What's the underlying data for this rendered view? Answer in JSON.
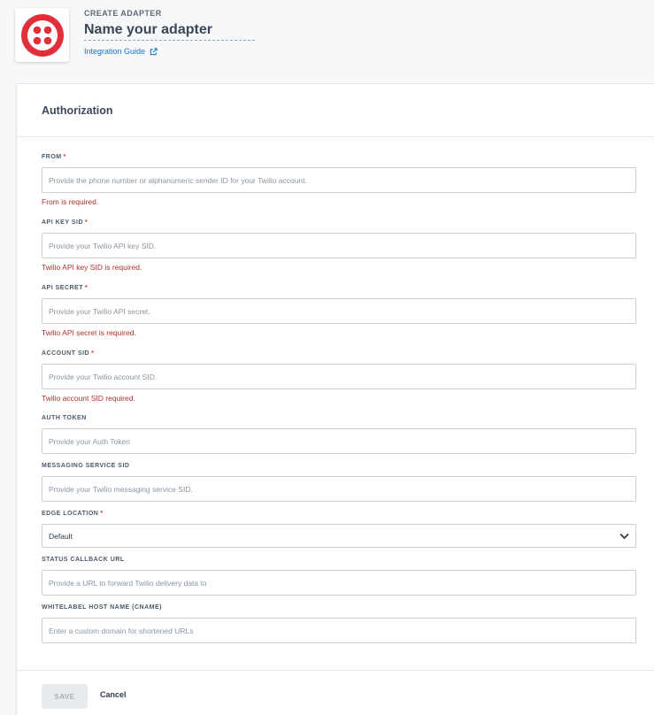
{
  "header": {
    "label": "CREATE ADAPTER",
    "name_placeholder": "Name your adapter",
    "guide_link": "Integration Guide"
  },
  "colors": {
    "brand": "#e12f3a",
    "link": "#1a73c7",
    "error": "#b0312a"
  },
  "card": {
    "title": "Authorization"
  },
  "fields": {
    "from": {
      "label": "FROM",
      "required": "*",
      "placeholder": "Provide the phone number or alphanumeric sender ID for your Twilio account.",
      "error": "From is required."
    },
    "api_key_sid": {
      "label": "API KEY SID",
      "required": "*",
      "placeholder": "Provide your Twilio API key SID.",
      "error": "Twilio API key SID is required."
    },
    "api_secret": {
      "label": "API SECRET",
      "required": "*",
      "placeholder": "Provide your Twilio API secret.",
      "error": "Twilio API secret is required."
    },
    "account_sid": {
      "label": "ACCOUNT SID",
      "required": "*",
      "placeholder": "Provide your Twilio account SID.",
      "error": "Twilio account SID required."
    },
    "auth_token": {
      "label": "AUTH TOKEN",
      "placeholder": "Provide your Auth Token"
    },
    "messaging_service_sid": {
      "label": "MESSAGING SERVICE SID",
      "placeholder": "Provide your Twilio messaging service SID."
    },
    "edge_location": {
      "label": "EDGE LOCATION",
      "required": "*",
      "value": "Default"
    },
    "status_callback_url": {
      "label": "STATUS CALLBACK URL",
      "placeholder": "Provide a URL to forward Twilio delivery data to"
    },
    "whitelabel_host": {
      "label": "WHITELABEL HOST NAME (CNAME)",
      "placeholder": "Enter a custom domain for shortened URLs"
    }
  },
  "footer": {
    "save_label": "SAVE",
    "cancel_label": "Cancel"
  }
}
